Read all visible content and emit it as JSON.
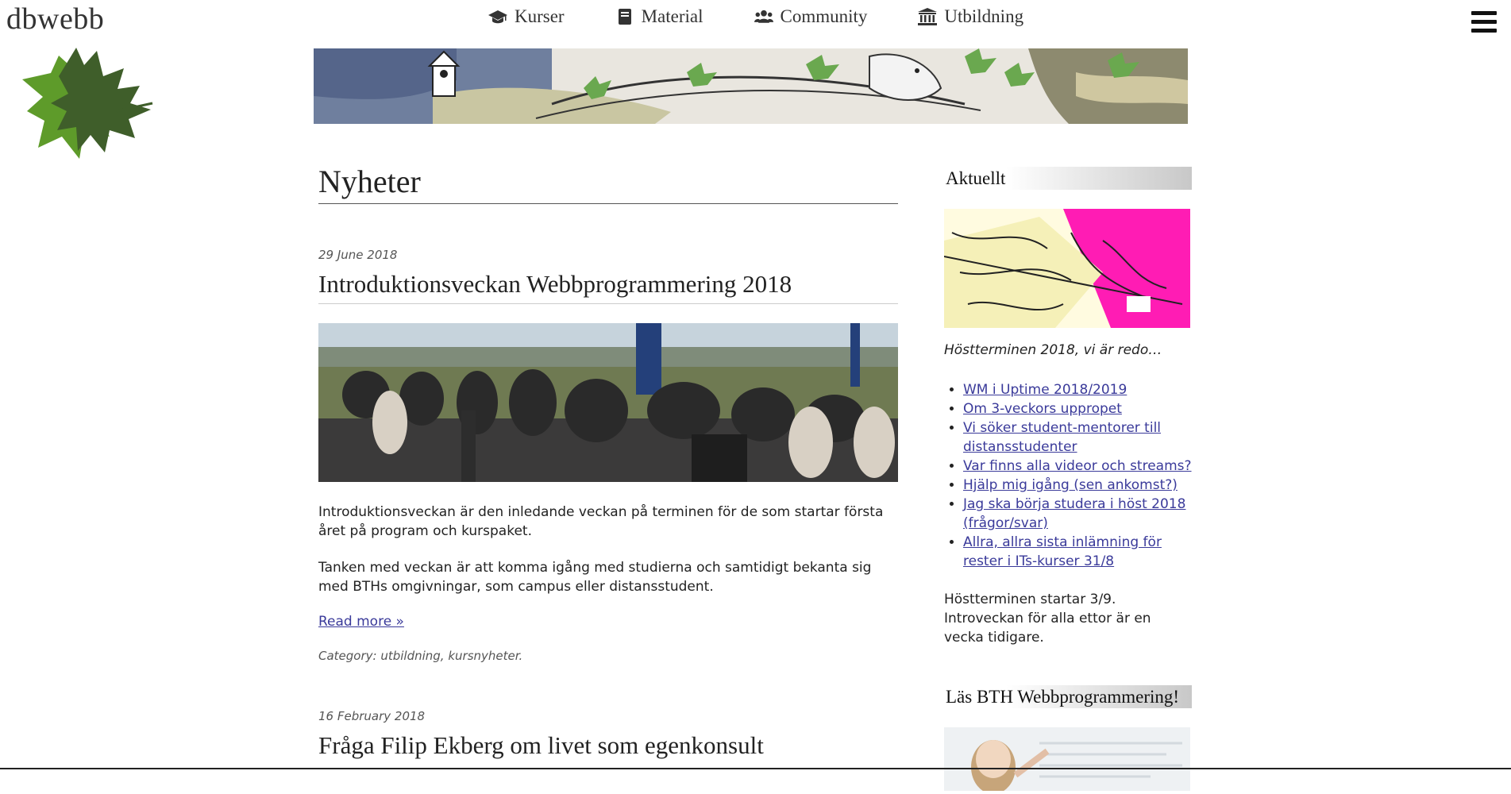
{
  "header": {
    "logo": "dbwebb",
    "nav": [
      {
        "label": "Kurser",
        "icon": "graduation-cap-icon"
      },
      {
        "label": "Material",
        "icon": "book-icon"
      },
      {
        "label": "Community",
        "icon": "users-icon"
      },
      {
        "label": "Utbildning",
        "icon": "university-icon"
      }
    ],
    "menu_icon": "hamburger-icon"
  },
  "main": {
    "title": "Nyheter",
    "posts": [
      {
        "date": "29 June 2018",
        "title": "Introduktionsveckan Webbprogrammering 2018",
        "paragraphs": [
          "Introduktionsveckan är den inledande veckan på terminen för de som startar första året på program och kurspaket.",
          "Tanken med veckan är att komma igång med studierna och samtidigt bekanta sig med BTHs omgivningar, som campus eller distansstudent."
        ],
        "read_more": "Read more »",
        "category": "Category: utbildning, kursnyheter."
      },
      {
        "date": "16 February 2018",
        "title": "Fråga Filip Ekberg om livet som egenkonsult"
      }
    ]
  },
  "sidebar": {
    "heading": "Aktuellt",
    "caption": "Höstterminen 2018, vi är redo…",
    "links": [
      "WM i Uptime 2018/2019",
      "Om 3-veckors uppropet",
      "Vi söker student-mentorer till distansstudenter",
      "Var finns alla videor och streams?",
      "Hjälp mig igång (sen ankomst?)",
      "Jag ska börja studera i höst 2018 (frågor/svar)",
      "Allra, allra sista inlämning för rester i ITs-kurser 31/8"
    ],
    "text": "Höstterminen startar 3/9. Introveckan för alla ettor är en vecka tidigare.",
    "heading2": "Läs BTH Webbprogrammering!"
  }
}
